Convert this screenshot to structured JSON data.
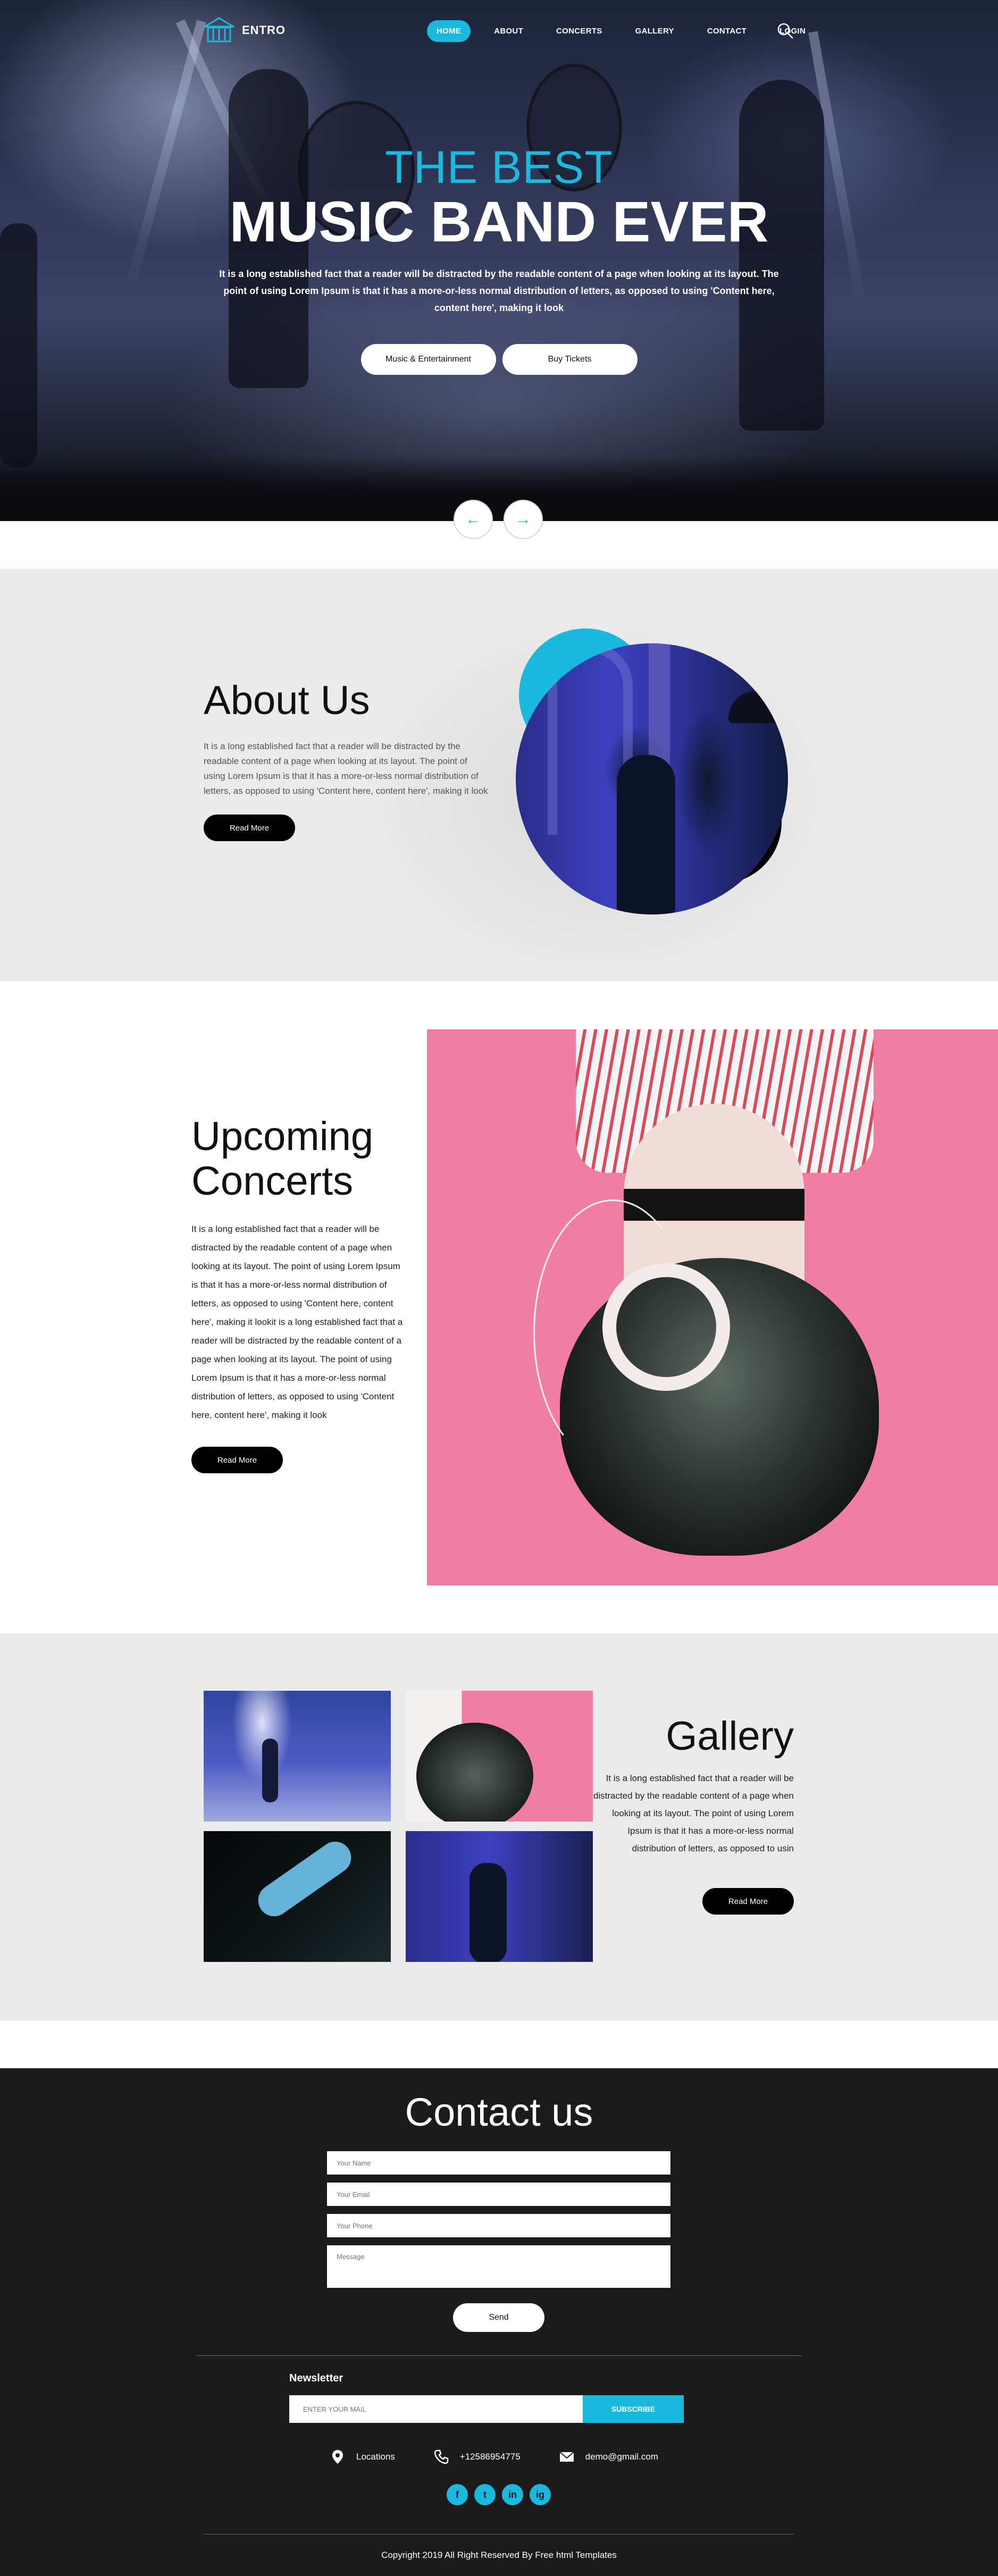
{
  "brand": {
    "name": "ENTRO"
  },
  "nav": {
    "items": [
      "HOME",
      "ABOUT",
      "CONCERTS",
      "GALLERY",
      "CONTACT",
      "LOGIN"
    ],
    "active": "HOME",
    "search_icon": "search-icon"
  },
  "hero": {
    "kicker": "THE BEST",
    "headline": "MUSIC BAND EVER",
    "lead": "It is a long established fact that a reader will be distracted by the readable content of a page when looking at its layout. The point of using Lorem Ipsum is that it has a more-or-less normal distribution of letters, as opposed to using 'Content here, content here', making it look",
    "button_primary": "Music & Entertainment",
    "button_secondary": "Buy Tickets",
    "prev_icon": "←",
    "next_icon": "→"
  },
  "about": {
    "title": "About Us",
    "body": "It is a long established fact that a reader will be distracted by the readable content of a page when looking at its layout. The point of using Lorem Ipsum is that it has a more-or-less normal distribution of letters, as opposed to using 'Content here, content here', making it look",
    "button": "Read More"
  },
  "concerts": {
    "title_line1": "Upcoming",
    "title_line2": "Concerts",
    "body": "It is a long established fact that a reader will be distracted by the readable content of a page when looking at its layout. The point of using Lorem Ipsum is that it has a more-or-less normal distribution of letters, as opposed to using 'Content here, content here', making it lookit is a long established fact that a reader will be distracted by the readable content of a page when looking at its layout. The point of using Lorem Ipsum is that it has a more-or-less normal distribution of letters, as opposed to using 'Content here, content here', making it look",
    "button": "Read More"
  },
  "gallery": {
    "title": "Gallery",
    "body": "It is a long established fact that a reader will be distracted by the readable content of a page when looking at its layout. The point of using Lorem Ipsum is that it has a more-or-less normal distribution of letters, as opposed to usin",
    "button": "Read More"
  },
  "contact": {
    "title": "Contact us",
    "name_placeholder": "Your Name",
    "email_placeholder": "Your Email",
    "phone_placeholder": "Your Phone",
    "message_placeholder": "Message",
    "send": "Send"
  },
  "newsletter": {
    "label": "Newsletter",
    "placeholder": "ENTER YOUR MAIL",
    "button": "SUBSCRIBE"
  },
  "footer": {
    "location": "Locations",
    "phone": "+12586954775",
    "email": "demo@gmail.com",
    "socials": [
      "f",
      "t",
      "in",
      "ig"
    ],
    "copyright": "Copyright 2019 All Right Reserved By Free html Templates"
  },
  "colors": {
    "accent": "#1cb9de",
    "dark": "#1b1b1b",
    "light_section": "#ebebeb"
  }
}
